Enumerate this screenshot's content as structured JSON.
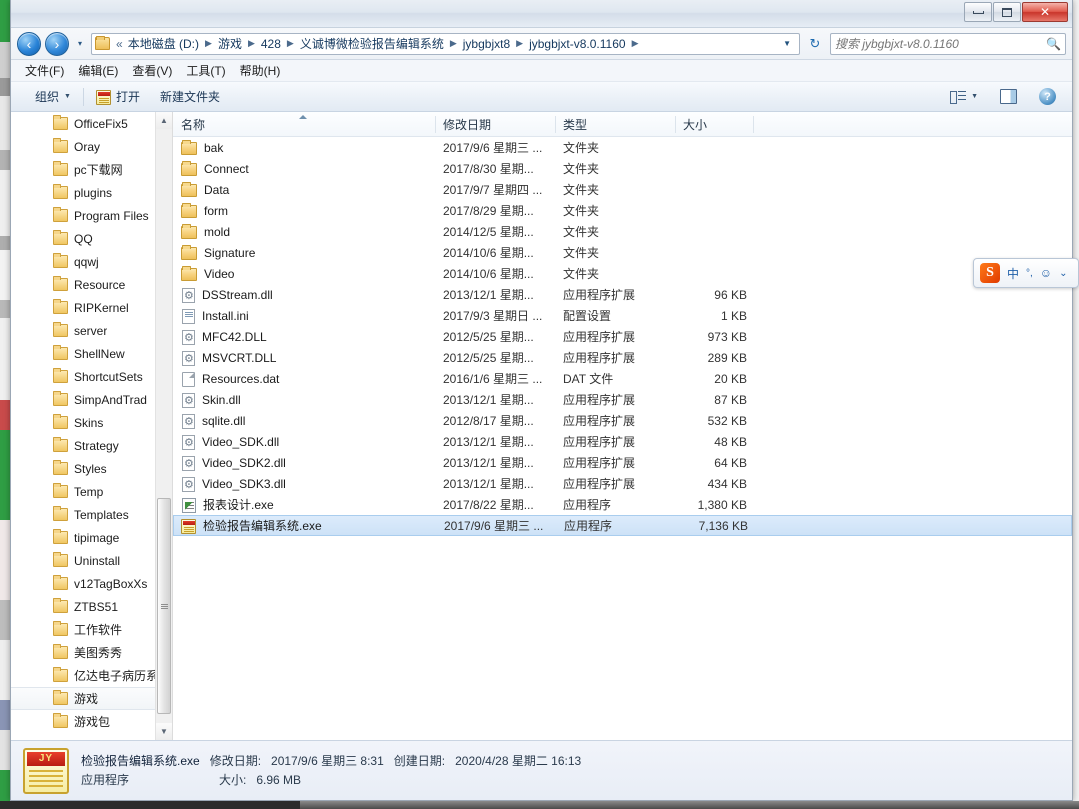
{
  "window": {
    "controls": {
      "minimize": "Minimize",
      "maximize": "Maximize",
      "close": "✕"
    }
  },
  "nav": {
    "back": "‹",
    "forward": "›",
    "recent_caret": "▾",
    "breadcrumb": [
      "本地磁盘 (D:)",
      "游戏",
      "428",
      "义诚博微检验报告编辑系统",
      "jybgbjxt8",
      "jybgbjxt-v8.0.1160"
    ],
    "breadcrumb_prefix": "«",
    "chevron": "▶",
    "address_caret": "▼",
    "refresh": "↻",
    "search": {
      "placeholder": "搜索 jybgbjxt-v8.0.1160",
      "value": "",
      "icon": "search-icon"
    }
  },
  "menubar": [
    {
      "label": "文件(F)"
    },
    {
      "label": "编辑(E)"
    },
    {
      "label": "查看(V)"
    },
    {
      "label": "工具(T)"
    },
    {
      "label": "帮助(H)"
    }
  ],
  "commandbar": {
    "organize": "组织",
    "organize_caret": "▼",
    "open": "打开",
    "new_folder": "新建文件夹",
    "views_caret": "▼",
    "icons": [
      "views-icon",
      "preview-pane-icon",
      "help-icon"
    ],
    "help_glyph": "?"
  },
  "navpane": {
    "items": [
      {
        "label": "OfficeFix5",
        "selected": false
      },
      {
        "label": "Oray",
        "selected": false
      },
      {
        "label": "pc下载网",
        "selected": false
      },
      {
        "label": "plugins",
        "selected": false
      },
      {
        "label": "Program Files",
        "selected": false
      },
      {
        "label": "QQ",
        "selected": false
      },
      {
        "label": "qqwj",
        "selected": false
      },
      {
        "label": "Resource",
        "selected": false
      },
      {
        "label": "RIPKernel",
        "selected": false
      },
      {
        "label": "server",
        "selected": false
      },
      {
        "label": "ShellNew",
        "selected": false
      },
      {
        "label": "ShortcutSets",
        "selected": false
      },
      {
        "label": "SimpAndTrad",
        "selected": false
      },
      {
        "label": "Skins",
        "selected": false
      },
      {
        "label": "Strategy",
        "selected": false
      },
      {
        "label": "Styles",
        "selected": false
      },
      {
        "label": "Temp",
        "selected": false
      },
      {
        "label": "Templates",
        "selected": false
      },
      {
        "label": "tipimage",
        "selected": false
      },
      {
        "label": "Uninstall",
        "selected": false
      },
      {
        "label": "v12TagBoxXs",
        "selected": false
      },
      {
        "label": "ZTBS51",
        "selected": false
      },
      {
        "label": "工作软件",
        "selected": false
      },
      {
        "label": "美图秀秀",
        "selected": false
      },
      {
        "label": "亿达电子病历系",
        "selected": false
      },
      {
        "label": "游戏",
        "selected": true
      },
      {
        "label": "游戏包",
        "selected": false
      }
    ],
    "scroll_up": "▲",
    "scroll_down": "▼"
  },
  "filelist": {
    "columns": [
      {
        "key": "name",
        "label": "名称",
        "sorted": true
      },
      {
        "key": "date",
        "label": "修改日期"
      },
      {
        "key": "type",
        "label": "类型"
      },
      {
        "key": "size",
        "label": "大小"
      }
    ],
    "rows": [
      {
        "icon": "folder-icon",
        "name": "bak",
        "date": "2017/9/6 星期三 ...",
        "type": "文件夹",
        "size": "",
        "selected": false
      },
      {
        "icon": "folder-icon",
        "name": "Connect",
        "date": "2017/8/30 星期...",
        "type": "文件夹",
        "size": "",
        "selected": false
      },
      {
        "icon": "folder-icon",
        "name": "Data",
        "date": "2017/9/7 星期四 ...",
        "type": "文件夹",
        "size": "",
        "selected": false
      },
      {
        "icon": "folder-icon",
        "name": "form",
        "date": "2017/8/29 星期...",
        "type": "文件夹",
        "size": "",
        "selected": false
      },
      {
        "icon": "folder-icon",
        "name": "mold",
        "date": "2014/12/5 星期...",
        "type": "文件夹",
        "size": "",
        "selected": false
      },
      {
        "icon": "folder-icon",
        "name": "Signature",
        "date": "2014/10/6 星期...",
        "type": "文件夹",
        "size": "",
        "selected": false
      },
      {
        "icon": "folder-icon",
        "name": "Video",
        "date": "2014/10/6 星期...",
        "type": "文件夹",
        "size": "",
        "selected": false
      },
      {
        "icon": "dll-icon",
        "name": "DSStream.dll",
        "date": "2013/12/1 星期...",
        "type": "应用程序扩展",
        "size": "96 KB",
        "selected": false
      },
      {
        "icon": "ini-icon",
        "name": "Install.ini",
        "date": "2017/9/3 星期日 ...",
        "type": "配置设置",
        "size": "1 KB",
        "selected": false
      },
      {
        "icon": "dll-icon",
        "name": "MFC42.DLL",
        "date": "2012/5/25 星期...",
        "type": "应用程序扩展",
        "size": "973 KB",
        "selected": false
      },
      {
        "icon": "dll-icon",
        "name": "MSVCRT.DLL",
        "date": "2012/5/25 星期...",
        "type": "应用程序扩展",
        "size": "289 KB",
        "selected": false
      },
      {
        "icon": "dat-icon",
        "name": "Resources.dat",
        "date": "2016/1/6 星期三 ...",
        "type": "DAT 文件",
        "size": "20 KB",
        "selected": false
      },
      {
        "icon": "dll-icon",
        "name": "Skin.dll",
        "date": "2013/12/1 星期...",
        "type": "应用程序扩展",
        "size": "87 KB",
        "selected": false
      },
      {
        "icon": "dll-icon",
        "name": "sqlite.dll",
        "date": "2012/8/17 星期...",
        "type": "应用程序扩展",
        "size": "532 KB",
        "selected": false
      },
      {
        "icon": "dll-icon",
        "name": "Video_SDK.dll",
        "date": "2013/12/1 星期...",
        "type": "应用程序扩展",
        "size": "48 KB",
        "selected": false
      },
      {
        "icon": "dll-icon",
        "name": "Video_SDK2.dll",
        "date": "2013/12/1 星期...",
        "type": "应用程序扩展",
        "size": "64 KB",
        "selected": false
      },
      {
        "icon": "dll-icon",
        "name": "Video_SDK3.dll",
        "date": "2013/12/1 星期...",
        "type": "应用程序扩展",
        "size": "434 KB",
        "selected": false
      },
      {
        "icon": "exe-report-icon",
        "name": "报表设计.exe",
        "date": "2017/8/22 星期...",
        "type": "应用程序",
        "size": "1,380 KB",
        "selected": false
      },
      {
        "icon": "exe-jy-icon",
        "name": "检验报告编辑系统.exe",
        "date": "2017/9/6 星期三 ...",
        "type": "应用程序",
        "size": "7,136 KB",
        "selected": true
      }
    ]
  },
  "details": {
    "icon": "exe-jy-icon",
    "badge": "JY",
    "filename": "检验报告编辑系统.exe",
    "modified_label": "修改日期:",
    "modified_value": "2017/9/6 星期三 8:31",
    "created_label": "创建日期:",
    "created_value": "2020/4/28 星期二 16:13",
    "kind": "应用程序",
    "size_label": "大小:",
    "size_value": "6.96 MB"
  },
  "ime": {
    "logo": "S",
    "lang": "中",
    "punct": "°,",
    "smiley": "☺",
    "more": "⌄"
  },
  "colors": {
    "accent": "#2a84d8",
    "selection": "#cde2f7",
    "folder": "#f0c661",
    "close_button": "#c9352b",
    "desktop_green": "#3cb44b"
  }
}
